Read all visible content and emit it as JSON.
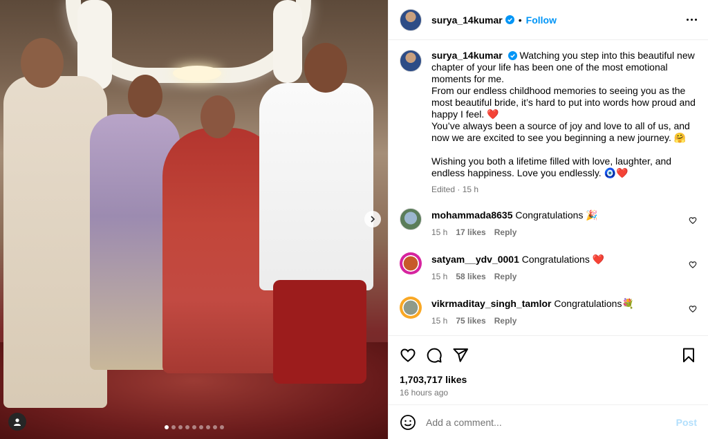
{
  "post": {
    "username": "surya_14kumar",
    "separator": "•",
    "follow_label": "Follow",
    "caption": "Watching you step into this beautiful new chapter of your life has been one of the most emotional moments for me.",
    "caption_p2": "From our endless childhood memories to seeing you as the most beautiful bride, it’s hard to put into words how proud and happy I feel. ❤️",
    "caption_p3": "You’ve always been a source of joy and love to all of us, and now we are excited to see you beginning a new journey. 🤗",
    "caption_p4": "Wishing you both a lifetime filled with love, laughter, and endless happiness. Love you endlessly. 🧿❤️",
    "edited": "Edited · 15 h",
    "likes": "1,703,717 likes",
    "time_ago": "16 hours ago",
    "carousel_dots": 9,
    "active_dot": 0
  },
  "comments": [
    {
      "user": "mohammada8635",
      "text": "Congratulations 🎉",
      "time": "15 h",
      "likes": "17 likes",
      "reply": "Reply"
    },
    {
      "user": "satyam__ydv_0001",
      "text": "Congratulations ❤️",
      "time": "15 h",
      "likes": "58 likes",
      "reply": "Reply"
    },
    {
      "user": "vikrmaditay_singh_tamlor",
      "text": "Congratulations💐",
      "time": "15 h",
      "likes": "75 likes",
      "reply": "Reply"
    }
  ],
  "add_comment": {
    "placeholder": "Add a comment...",
    "post_label": "Post"
  },
  "icons": {
    "more": "more-horizontal-icon",
    "verified": "verified-badge-icon",
    "like": "heart-icon",
    "comment": "comment-icon",
    "share": "share-icon",
    "save": "bookmark-icon",
    "emoji": "emoji-icon",
    "tag": "user-tag-icon",
    "next": "chevron-right-icon"
  },
  "colors": {
    "accent": "#0095f6",
    "heart": "#e0245e",
    "muted": "#737373"
  }
}
